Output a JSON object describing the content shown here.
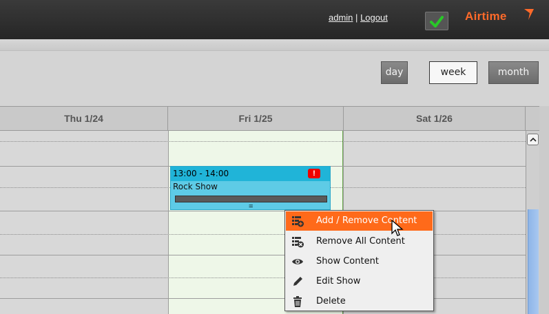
{
  "header": {
    "user_link": "admin",
    "separator": "|",
    "logout_link": "Logout",
    "brand": "Airtime",
    "brand_color": "#ff6a2a",
    "status_icon": "check-icon"
  },
  "view_switcher": {
    "day": "day",
    "week": "week",
    "month": "month",
    "active": "week"
  },
  "calendar": {
    "columns": [
      "Thu 1/24",
      "Fri 1/25",
      "Sat 1/26"
    ],
    "today": "Fri 1/25"
  },
  "event": {
    "time": "13:00 - 14:00",
    "title": "Rock Show",
    "alert": "!",
    "handle": "="
  },
  "context_menu": {
    "items": [
      {
        "label": "Add / Remove Content",
        "icon": "add-content-icon",
        "highlighted": true
      },
      {
        "label": "Remove All Content",
        "icon": "remove-content-icon"
      },
      {
        "label": "Show Content",
        "icon": "eye-icon"
      },
      {
        "label": "Edit Show",
        "icon": "pencil-icon"
      },
      {
        "label": "Delete",
        "icon": "trash-icon"
      }
    ]
  }
}
